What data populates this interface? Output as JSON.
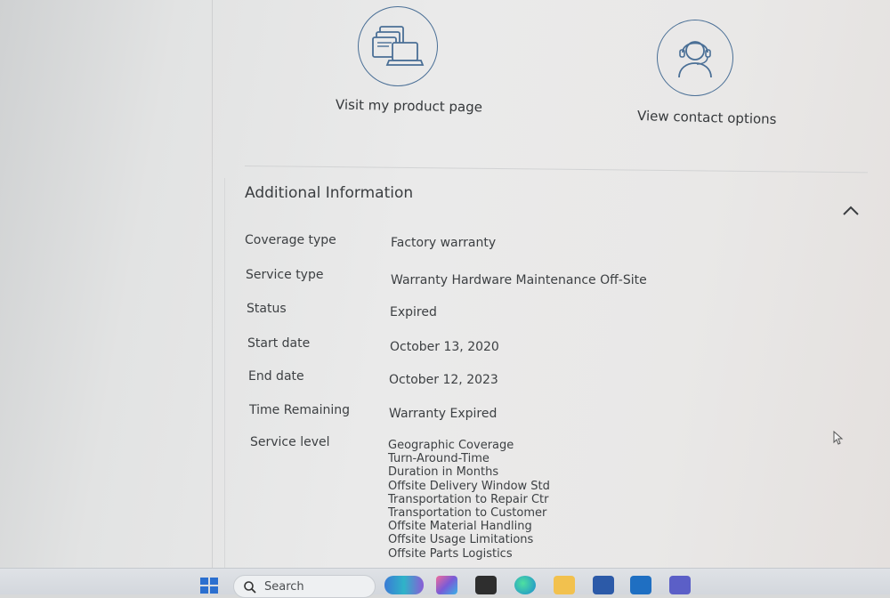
{
  "cards": [
    {
      "icon": "devices-icon",
      "label": "Visit my product page"
    },
    {
      "icon": "headset-agent-icon",
      "label": "View contact options"
    }
  ],
  "section": {
    "title": "Additional Information",
    "toggle_icon": "chevron-up-icon"
  },
  "rows": [
    {
      "label": "Coverage type",
      "value": "Factory warranty"
    },
    {
      "label": "Service type",
      "value": "Warranty Hardware Maintenance Off-Site"
    },
    {
      "label": "Status",
      "value": "Expired"
    },
    {
      "label": "Start date",
      "value": "October 13, 2020"
    },
    {
      "label": "End date",
      "value": "October 12, 2023"
    },
    {
      "label": "Time Remaining",
      "value": "Warranty Expired"
    }
  ],
  "service_level": {
    "label": "Service level",
    "items": [
      "Geographic Coverage",
      "Turn-Around-Time",
      "Duration in Months",
      "Offsite Delivery Window Std",
      "Transportation to Repair Ctr",
      "Transportation to Customer",
      "Offsite Material Handling",
      "Offsite Usage Limitations",
      "Offsite Parts Logistics"
    ]
  },
  "taskbar": {
    "search_label": "Search",
    "apps": [
      "start-icon",
      "copilot-icon",
      "photos-icon",
      "terminal-icon",
      "edge-icon",
      "file-explorer-icon",
      "store-icon",
      "mail-icon",
      "teams-icon"
    ]
  },
  "colors": {
    "icon_stroke": "#4a6f96",
    "text": "#3d4043",
    "background": "#eaeaea"
  }
}
